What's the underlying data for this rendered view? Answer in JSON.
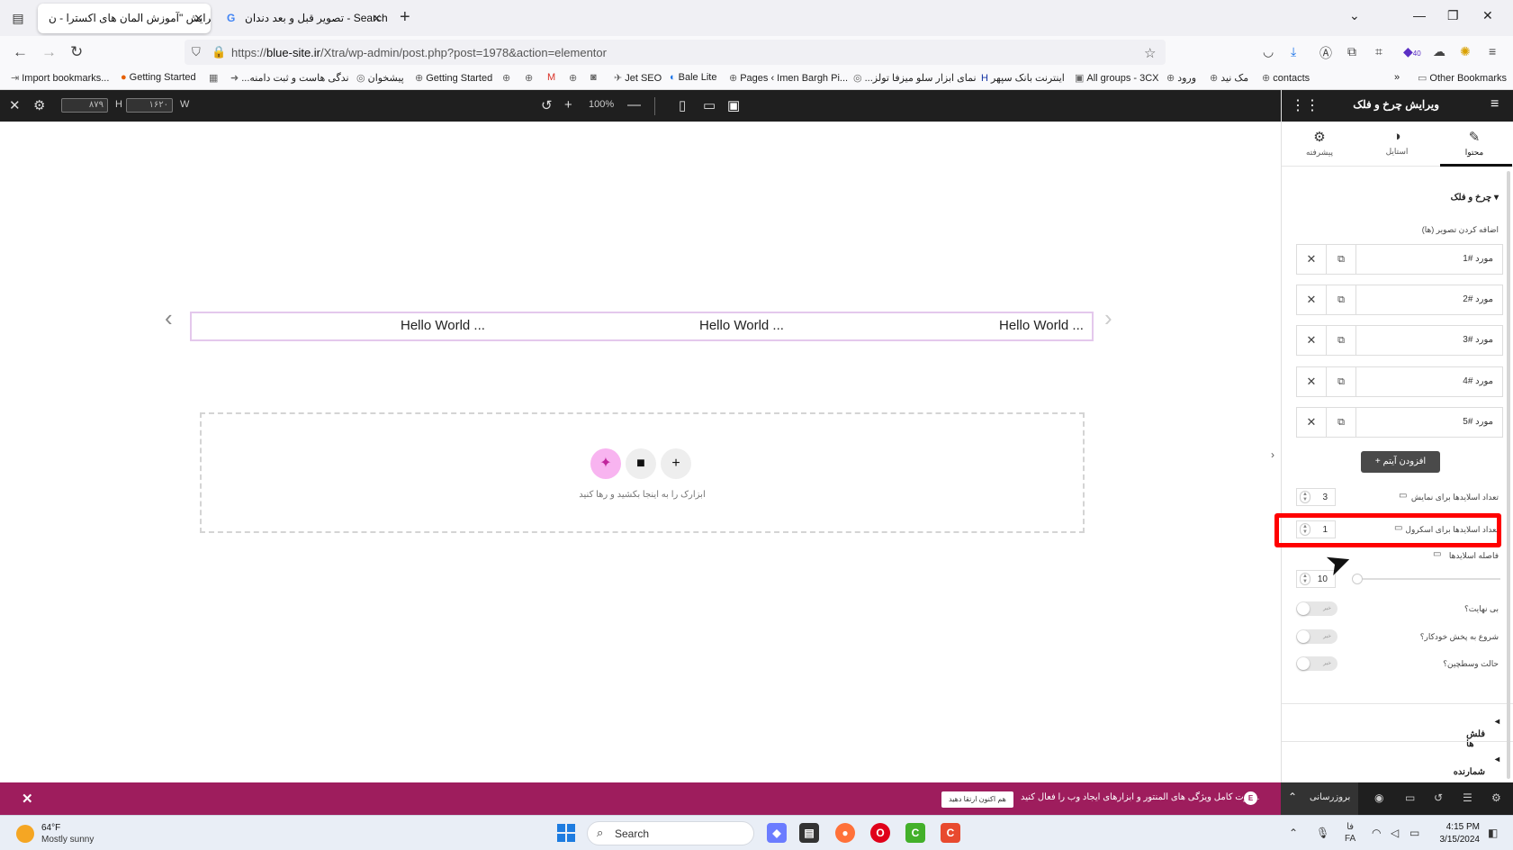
{
  "browser": {
    "tabs": [
      {
        "title": "ویرایش \"آموزش المان های اکسترا - ن",
        "active": true
      },
      {
        "title": "تصویر قبل و بعد دندان - Search",
        "active": false
      }
    ],
    "url_prefix": "https://",
    "url_host": "blue-site.ir",
    "url_path": "/Xtra/wp-admin/post.php?post=1978&action=elementor",
    "bookmarks": [
      "Import bookmarks...",
      "Getting Started",
      "...ندگی هاست و ثبت دامنه",
      "پیشخوان",
      "Getting Started",
      "Jet SEO",
      "Bale Lite",
      "Pages ‹ Imen Bargh Pi...",
      "...نمای ابزار سلو میزفا تولز",
      "اینترنت بانک سپهر",
      "All groups - 3CX",
      "ورود",
      "مک نید",
      "contacts",
      "Other Bookmarks"
    ],
    "ext_badge": "40"
  },
  "editor_top": {
    "width_label": "W",
    "height_label": "H",
    "width_value": "۱۶۲۰",
    "height_value": "۸۷۹",
    "zoom": "100%"
  },
  "canvas": {
    "slides": [
      "Hello World ...",
      "Hello World ...",
      "Hello World ..."
    ],
    "drop_text": "ابزارک را به اینجا بکشید و رها کنید"
  },
  "panel": {
    "title": "ویرایش چرخ و فلک",
    "tabs": [
      "محتوا",
      "استایل",
      "پیشرفته"
    ],
    "section": "چرخ و فلک",
    "add_images_label": "اضافه کردن تصویر (ها)",
    "items": [
      "مورد #1",
      "مورد #2",
      "مورد #3",
      "مورد #4",
      "مورد #5"
    ],
    "add_item": "افزودن آیتم",
    "slides_to_show_label": "تعداد اسلایدها برای نمایش",
    "slides_to_show": "3",
    "slides_to_scroll_label": "تعداد اسلایدها برای اسکرول",
    "slides_to_scroll": "1",
    "slide_gap_label": "فاصله اسلایدها",
    "slide_gap": "10",
    "infinite_label": "بی نهایت؟",
    "autoplay_label": "شروع به پخش خودکار؟",
    "center_label": "حالت وسطچین؟",
    "toggle_text": "خیر",
    "section_arrows": "فلش ها",
    "section_counter": "شمارنده"
  },
  "promo": {
    "text": "قدرت کامل ویژگی های المنتور و ابزارهای ایجاد وب را فعال کنید.",
    "button": "هم اکنون ارتقا دهید"
  },
  "bottom_bar": {
    "publish": "بروزرسانی"
  },
  "taskbar": {
    "temp": "64°F",
    "weather": "Mostly sunny",
    "search": "Search",
    "lang_top": "فا",
    "lang_bottom": "FA",
    "time": "4:15 PM",
    "date": "3/15/2024"
  }
}
